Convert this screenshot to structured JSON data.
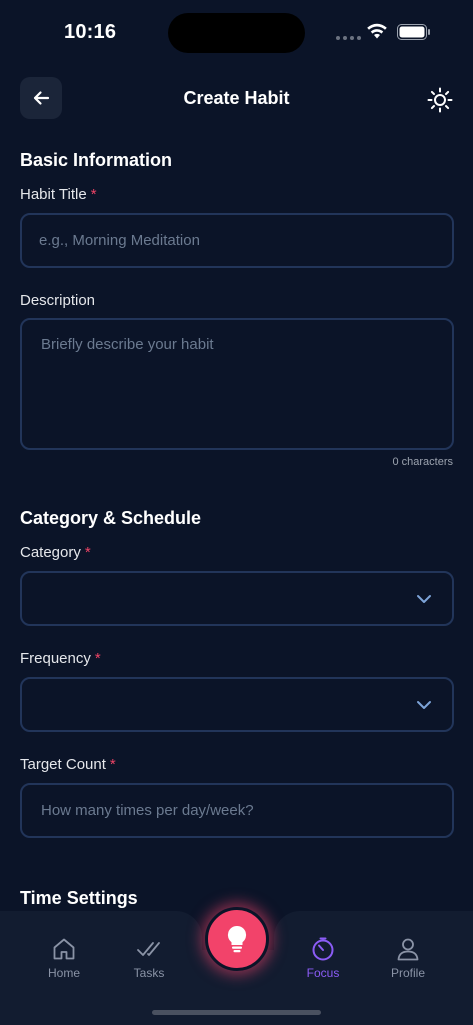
{
  "status_bar": {
    "time": "10:16"
  },
  "header": {
    "title": "Create Habit"
  },
  "sections": {
    "basic": "Basic Information",
    "schedule": "Category & Schedule",
    "time": "Time Settings"
  },
  "fields": {
    "title": {
      "label": "Habit Title",
      "required_mark": "*",
      "placeholder": "e.g., Morning Meditation"
    },
    "description": {
      "label": "Description",
      "placeholder": "Briefly describe your habit",
      "char_count": "0 characters"
    },
    "category": {
      "label": "Category",
      "required_mark": "*",
      "value": ""
    },
    "frequency": {
      "label": "Frequency",
      "required_mark": "*",
      "value": ""
    },
    "target": {
      "label": "Target Count",
      "required_mark": "*",
      "placeholder": "How many times per day/week?"
    }
  },
  "nav": {
    "items": [
      {
        "label": "Home",
        "icon": "home-icon",
        "active": false
      },
      {
        "label": "Tasks",
        "icon": "double-check-icon",
        "active": false
      },
      {
        "label": "Focus",
        "icon": "timer-icon",
        "active": true
      },
      {
        "label": "Profile",
        "icon": "person-icon",
        "active": false
      }
    ],
    "fab_icon": "lightbulb-icon"
  },
  "colors": {
    "background": "#0b1428",
    "accent": "#8b5cf6",
    "fab": "#f2436a",
    "required": "#ef4466",
    "input_border": "#22355a"
  }
}
